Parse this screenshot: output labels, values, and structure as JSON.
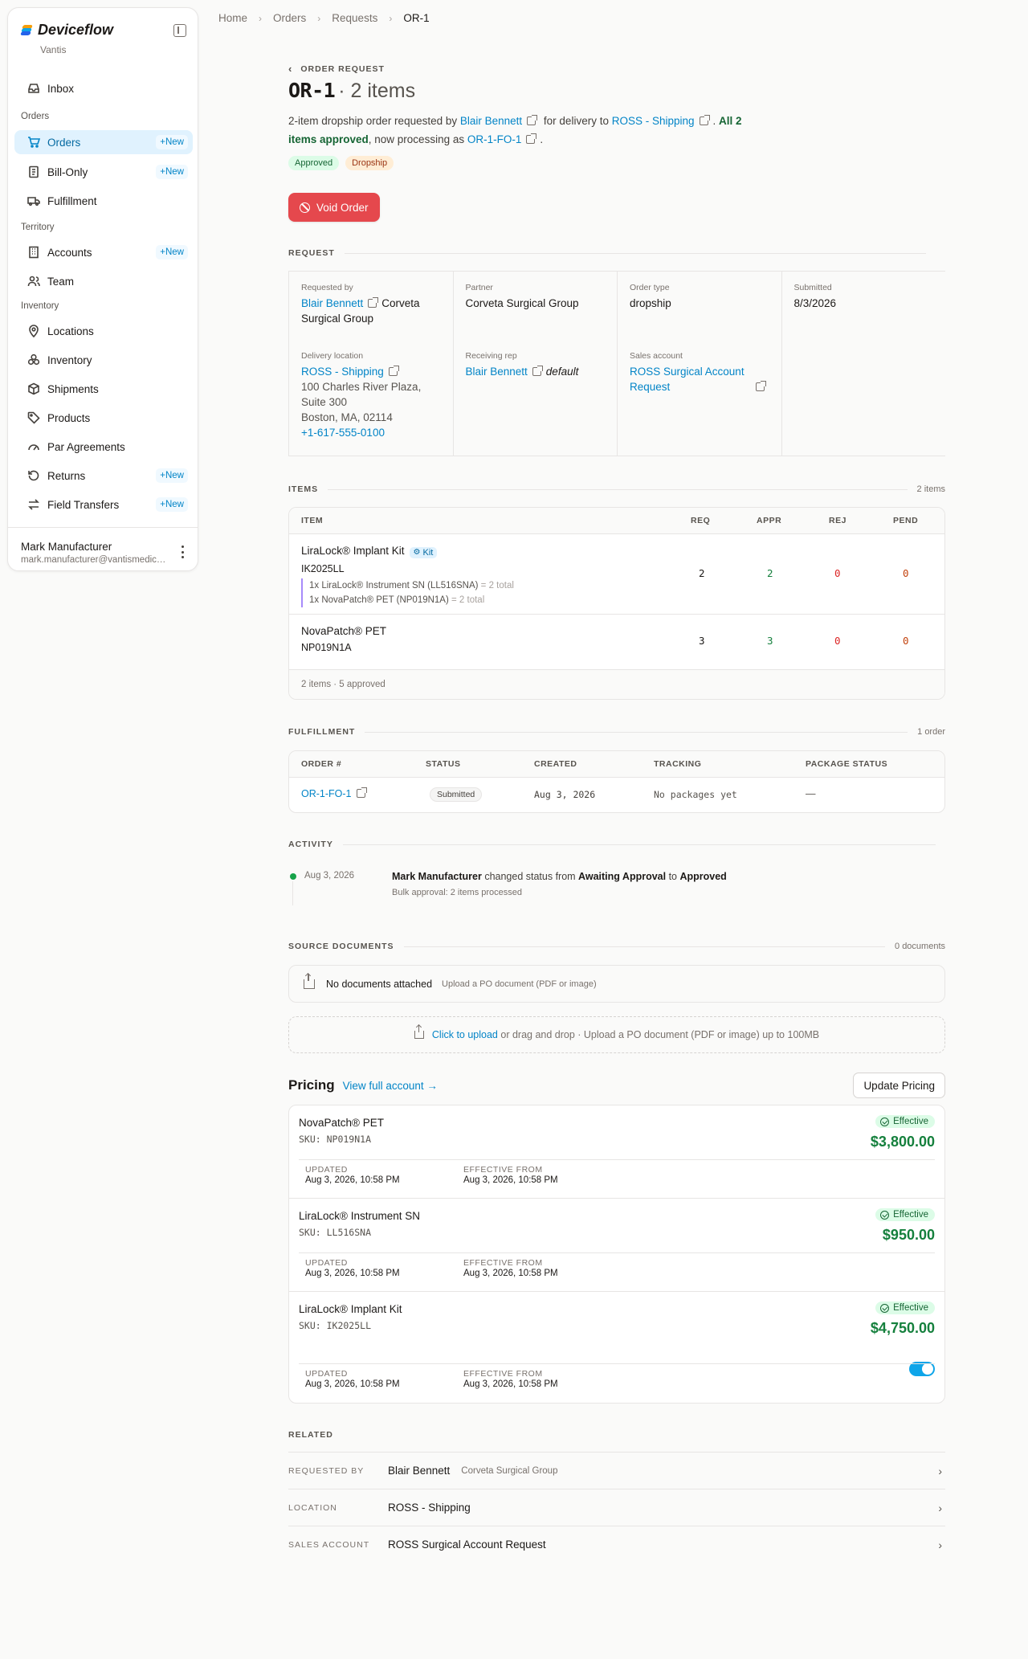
{
  "sidebar": {
    "brand": "Deviceflow",
    "org": "Vantis",
    "inbox": "Inbox",
    "section_orders": "Orders",
    "orders": "Orders",
    "bill_only": "Bill-Only",
    "fulfillment": "Fulfillment",
    "section_territory": "Territory",
    "accounts": "Accounts",
    "team": "Team",
    "section_inventory": "Inventory",
    "locations": "Locations",
    "inventory": "Inventory",
    "shipments": "Shipments",
    "products": "Products",
    "par_agreements": "Par Agreements",
    "returns": "Returns",
    "field_transfers": "Field Transfers",
    "new_label": "New",
    "user_name": "Mark Manufacturer",
    "user_email": "mark.manufacturer@vantismedical.com"
  },
  "breadcrumb": [
    "Home",
    "Orders",
    "Requests",
    "OR-1"
  ],
  "header": {
    "eyebrow": "ORDER REQUEST",
    "order_id": "OR-1",
    "title_rest": "· 2 items",
    "summary_p1": "2-item dropship order requested by ",
    "requester": "Blair Bennett",
    "summary_p2": " for delivery to ",
    "location": "ROSS - Shipping",
    "summary_p3": ". ",
    "approved_text": "All 2 items approved",
    "summary_p4": ", now processing as ",
    "fo_id": "OR-1-FO-1",
    "summary_p5": ".",
    "badge_status": "Approved",
    "badge_type": "Dropship",
    "void_label": "Void Order"
  },
  "request": {
    "section": "REQUEST",
    "requested_by_label": "Requested by",
    "requested_by": "Blair Bennett",
    "requested_by_org": "Corveta Surgical Group",
    "partner_label": "Partner",
    "partner": "Corveta Surgical Group",
    "order_type_label": "Order type",
    "order_type": "dropship",
    "submitted_label": "Submitted",
    "submitted": "8/3/2026",
    "delivery_label": "Delivery location",
    "delivery_name": "ROSS - Shipping",
    "delivery_addr1": "100 Charles River Plaza,",
    "delivery_addr2": "Suite 300",
    "delivery_addr3": "Boston, MA, 02114",
    "delivery_phone": "+1-617-555-0100",
    "rep_label": "Receiving rep",
    "rep": "Blair Bennett",
    "rep_default": "default",
    "sales_label": "Sales account",
    "sales_account": "ROSS Surgical Account Request"
  },
  "items": {
    "section": "ITEMS",
    "count": "2 items",
    "headers": [
      "ITEM",
      "REQ",
      "APPR",
      "REJ",
      "PEND"
    ],
    "rows": [
      {
        "name": "LiraLock® Implant Kit",
        "kit": "Kit",
        "sku": "IK2025LL",
        "components": [
          {
            "text": "1x LiraLock® Instrument SN (LL516SNA)",
            "total": "= 2 total"
          },
          {
            "text": "1x NovaPatch® PET (NP019N1A)",
            "total": "= 2 total"
          }
        ],
        "req": "2",
        "appr": "2",
        "rej": "0",
        "pend": "0"
      },
      {
        "name": "NovaPatch® PET",
        "sku": "NP019N1A",
        "req": "3",
        "appr": "3",
        "rej": "0",
        "pend": "0"
      }
    ],
    "footer": "2 items · 5 approved"
  },
  "fulfillment": {
    "section": "FULFILLMENT",
    "count": "1 order",
    "headers": [
      "ORDER #",
      "STATUS",
      "CREATED",
      "TRACKING",
      "PACKAGE STATUS"
    ],
    "row": {
      "order": "OR-1-FO-1",
      "status": "Submitted",
      "created": "Aug 3, 2026",
      "tracking": "No packages yet",
      "package": "—"
    }
  },
  "activity": {
    "section": "ACTIVITY",
    "date": "Aug 3, 2026",
    "actor": "Mark Manufacturer",
    "t1": " changed status from ",
    "from": "Awaiting Approval",
    "t2": " to ",
    "to": "Approved",
    "note": "Bulk approval: 2 items processed"
  },
  "documents": {
    "section": "SOURCE DOCUMENTS",
    "count": "0 documents",
    "empty": "No documents attached",
    "empty_hint": "Upload a PO document (PDF or image)",
    "upload_link": "Click to upload",
    "upload_rest": " or drag and drop · Upload a PO document (PDF or image) up to 100MB"
  },
  "pricing": {
    "title": "Pricing",
    "view_link": "View full account →",
    "update_btn": "Update Pricing",
    "updated_label": "UPDATED",
    "effective_label": "EFFECTIVE FROM",
    "status": "Effective",
    "items": [
      {
        "name": "NovaPatch® PET",
        "sku": "SKU: NP019N1A",
        "amount": "$3,800.00",
        "updated": "Aug 3, 2026, 10:58 PM",
        "effective": "Aug 3, 2026, 10:58 PM"
      },
      {
        "name": "LiraLock® Instrument SN",
        "sku": "SKU: LL516SNA",
        "amount": "$950.00",
        "updated": "Aug 3, 2026, 10:58 PM",
        "effective": "Aug 3, 2026, 10:58 PM"
      },
      {
        "name": "LiraLock® Implant Kit",
        "sku": "SKU: IK2025LL",
        "amount": "$4,750.00",
        "updated": "Aug 3, 2026, 10:58 PM",
        "effective": "Aug 3, 2026, 10:58 PM",
        "toggle_on": true
      }
    ]
  },
  "related": {
    "section": "RELATED",
    "rows": [
      {
        "label": "REQUESTED BY",
        "value": "Blair Bennett",
        "sub": "Corveta Surgical Group"
      },
      {
        "label": "LOCATION",
        "value": "ROSS - Shipping",
        "sub": ""
      },
      {
        "label": "SALES ACCOUNT",
        "value": "ROSS Surgical Account Request",
        "sub": ""
      }
    ]
  },
  "colors": {
    "accent": "#0284c7",
    "danger": "#e5484d",
    "success": "#15803d"
  }
}
